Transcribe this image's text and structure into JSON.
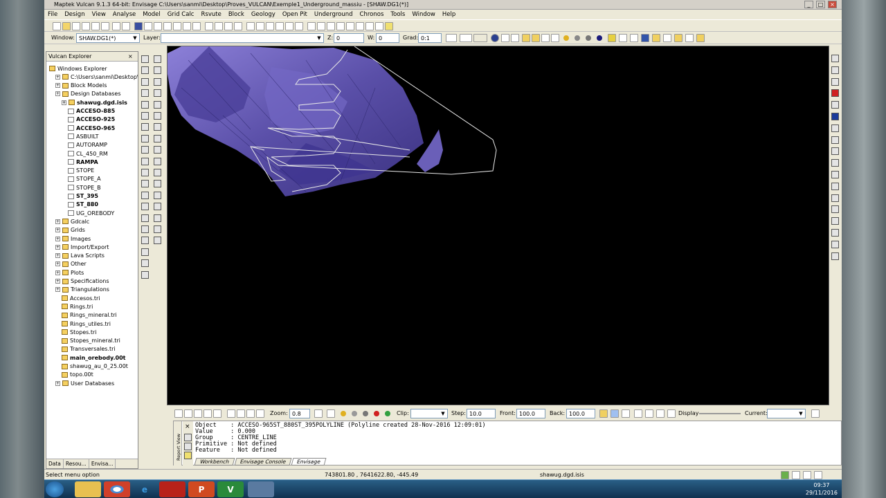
{
  "window": {
    "title": "Maptek Vulcan 9.1.3 64-bit: Envisage  C:\\Users\\sanmi\\Desktop\\Proves_VULCAN\\Exemple1_Underground_massiu - [SHAW.DG1(*)]"
  },
  "menu": [
    "File",
    "Design",
    "View",
    "Analyse",
    "Model",
    "Grid Calc",
    "Rsvute",
    "Block",
    "Geology",
    "Open Pit",
    "Underground",
    "Chronos",
    "Tools",
    "Window",
    "Help"
  ],
  "toolbar2": {
    "window_label": "Window:",
    "window_value": "SHAW.DG1(*)",
    "layer_label": "Layer:",
    "layer_value": "",
    "z_label": "Z:",
    "z_value": "0",
    "w_label": "W:",
    "w_value": "0",
    "grad_label": "Grad:",
    "grad_value": "0:1"
  },
  "explorer": {
    "title": "Vulcan Explorer",
    "close": "×",
    "items": [
      {
        "label": "Windows Explorer",
        "level": 0
      },
      {
        "label": "C:\\Users\\sanmi\\Desktop\\Prov",
        "level": 1
      },
      {
        "label": "Block Models",
        "level": 1
      },
      {
        "label": "Design Databases",
        "level": 1
      },
      {
        "label": "shawug.dgd.isis",
        "level": 2,
        "bold": true
      },
      {
        "label": "ACCESO-885",
        "level": 3,
        "bold": true
      },
      {
        "label": "ACCESO-925",
        "level": 3,
        "bold": true
      },
      {
        "label": "ACCESO-965",
        "level": 3,
        "bold": true
      },
      {
        "label": "ASBUILT",
        "level": 3
      },
      {
        "label": "AUTORAMP",
        "level": 3
      },
      {
        "label": "CL_450_RM",
        "level": 3
      },
      {
        "label": "RAMPA",
        "level": 3,
        "bold": true
      },
      {
        "label": "STOPE",
        "level": 3
      },
      {
        "label": "STOPE_A",
        "level": 3
      },
      {
        "label": "STOPE_B",
        "level": 3
      },
      {
        "label": "ST_395",
        "level": 3,
        "bold": true
      },
      {
        "label": "ST_880",
        "level": 3,
        "bold": true
      },
      {
        "label": "UG_OREBODY",
        "level": 3
      },
      {
        "label": "Gdcalc",
        "level": 1
      },
      {
        "label": "Grids",
        "level": 1
      },
      {
        "label": "Images",
        "level": 1
      },
      {
        "label": "Import/Export",
        "level": 1
      },
      {
        "label": "Lava Scripts",
        "level": 1
      },
      {
        "label": "Other",
        "level": 1
      },
      {
        "label": "Plots",
        "level": 1
      },
      {
        "label": "Specifications",
        "level": 1
      },
      {
        "label": "Triangulations",
        "level": 1
      },
      {
        "label": "Accesos.tri",
        "level": 2
      },
      {
        "label": "Rings.tri",
        "level": 2
      },
      {
        "label": "Rings_mineral.tri",
        "level": 2
      },
      {
        "label": "Rings_utiles.tri",
        "level": 2
      },
      {
        "label": "Stopes.tri",
        "level": 2
      },
      {
        "label": "Stopes_mineral.tri",
        "level": 2
      },
      {
        "label": "Transversales.tri",
        "level": 2
      },
      {
        "label": "main_orebody.00t",
        "level": 2,
        "bold": true
      },
      {
        "label": "shawug_au_0_25.00t",
        "level": 2
      },
      {
        "label": "topo.00t",
        "level": 2
      },
      {
        "label": "User Databases",
        "level": 1
      }
    ],
    "tabs": [
      "Data",
      "Resou...",
      "Envisa..."
    ]
  },
  "viewbar": {
    "zoom_label": "Zoom:",
    "zoom_value": "0.8",
    "clip_label": "Clip:",
    "step_label": "Step:",
    "step_value": "10.0",
    "front_label": "Front:",
    "front_value": "100.0",
    "back_label": "Back:",
    "back_value": "100.0",
    "display_label": "Display",
    "current_label": "Current:"
  },
  "report": {
    "side_label": "Report View",
    "lines": [
      "Object    : ACCESO-965ST_880ST_395POLYLINE (Polyline created 28-Nov-2016 12:09:01)",
      "Value     : 0.000",
      "Group     : CENTRE_LINE",
      "Primitive : Not defined",
      "Feature   : Not defined"
    ],
    "tabs": [
      "Workbench",
      "Envisage Console",
      "Envisage"
    ]
  },
  "status": {
    "message": "Select menu option",
    "coords": "743801.80 , 7641622.80, -445.49",
    "database": "shawug.dgd.isis"
  },
  "taskbar": {
    "start": "Start",
    "time": "09:37",
    "date": "29/11/2016"
  },
  "colors": {
    "ore_body": "#6a5fb8",
    "viewport_bg": "#000000",
    "polyline": "#e8e8e8"
  }
}
